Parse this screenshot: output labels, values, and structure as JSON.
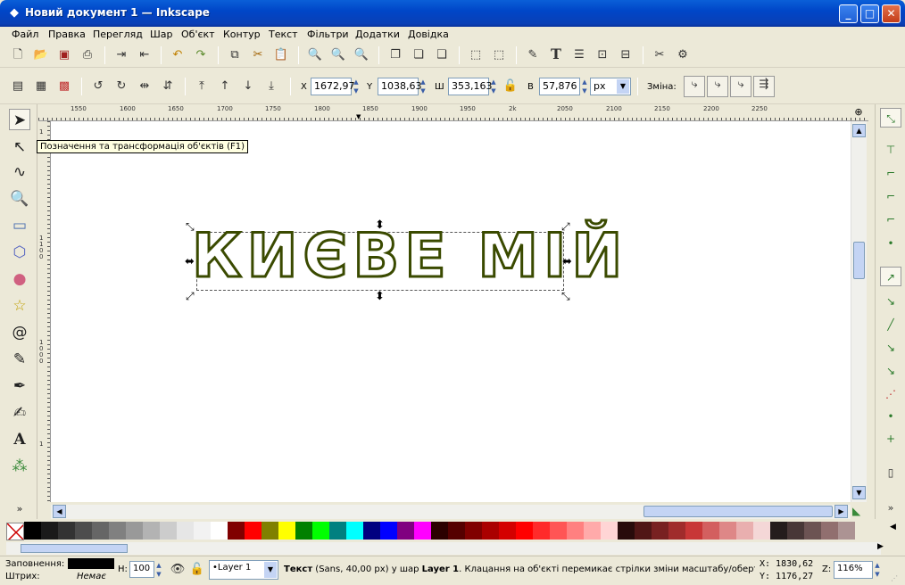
{
  "window": {
    "title": "Новий документ 1 — Inkscape",
    "min_label": "_",
    "max_label": "□",
    "close_label": "✕"
  },
  "menu": [
    "Файл",
    "Правка",
    "Перегляд",
    "Шар",
    "Об'єкт",
    "Контур",
    "Текст",
    "Фільтри",
    "Додатки",
    "Довідка"
  ],
  "tool_controls": {
    "x_label": "X",
    "x_value": "1672,97",
    "y_label": "Y",
    "y_value": "1038,63",
    "w_label": "Ш",
    "w_value": "353,163",
    "h_label": "В",
    "h_value": "57,876",
    "unit": "px",
    "change_label": "Зміна:"
  },
  "ruler": {
    "h_ticks": [
      "1550",
      "1600",
      "1650",
      "1700",
      "1750",
      "1800",
      "1850",
      "1900",
      "1950",
      "2k",
      "2050",
      "2100",
      "2150",
      "2200",
      "2250"
    ],
    "v_ticks": [
      "1",
      "1100",
      "1000",
      "1"
    ]
  },
  "canvas": {
    "text": "КИЄВЕ МІЙ"
  },
  "tooltip": "Позначення та трансформація об'єктів (F1)",
  "palette": [
    "#000000",
    "#1a1a1a",
    "#333333",
    "#4d4d4d",
    "#666666",
    "#808080",
    "#999999",
    "#b3b3b3",
    "#cccccc",
    "#e6e6e6",
    "#f2f2f2",
    "#ffffff",
    "#800000",
    "#ff0000",
    "#808000",
    "#ffff00",
    "#008000",
    "#00ff00",
    "#008080",
    "#00ffff",
    "#000080",
    "#0000ff",
    "#800080",
    "#ff00ff",
    "#2b0000",
    "#550000",
    "#800000",
    "#aa0000",
    "#d40000",
    "#ff0000",
    "#ff2a2a",
    "#ff5555",
    "#ff8080",
    "#ffaaaa",
    "#ffd5d5",
    "#280b0b",
    "#501616",
    "#782121",
    "#a02c2c",
    "#c83737",
    "#d35f5f",
    "#de8787",
    "#e9afaf",
    "#f4d7d7",
    "#241c1c",
    "#483737",
    "#6c5353",
    "#916f6f",
    "#ac9393"
  ],
  "status": {
    "fill_label": "Заповнення:",
    "stroke_label": "Штрих:",
    "stroke_value": "Немає",
    "opacity_label": "Н:",
    "opacity_value": "100",
    "layer": "•Layer 1",
    "message_prefix": "Текст",
    "message_detail": " (Sans, 40,00 px) у шар ",
    "message_layer": "Layer 1",
    "message_rest": ". Клацання на об'єкті перемикає стрілки зміни масштабу/обертанн",
    "x_coord": "X: 1830,62",
    "y_coord": "Y: 1176,27",
    "zoom_label": "Z:",
    "zoom_value": "116%"
  },
  "colors": {
    "title_bar": "#0a5fd8",
    "text_stroke": "#3a4a00",
    "canvas": "#ffffff"
  }
}
